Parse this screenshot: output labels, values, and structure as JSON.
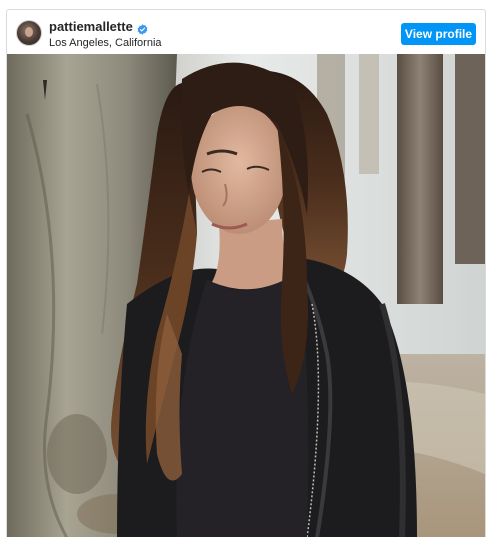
{
  "post": {
    "username": "pattiemallette",
    "verified": true,
    "location": "Los Angeles, California",
    "view_profile_label": "View profile"
  },
  "colors": {
    "accent": "#0095f6",
    "verified_badge": "#3897f0",
    "text": "#262626",
    "border": "#dbdbdb"
  },
  "icons": {
    "avatar": "profile-photo",
    "verified": "verified-badge-icon"
  },
  "media": {
    "type": "photo",
    "subject": "woman with long wavy brown hair in black leather jacket under a pier"
  }
}
